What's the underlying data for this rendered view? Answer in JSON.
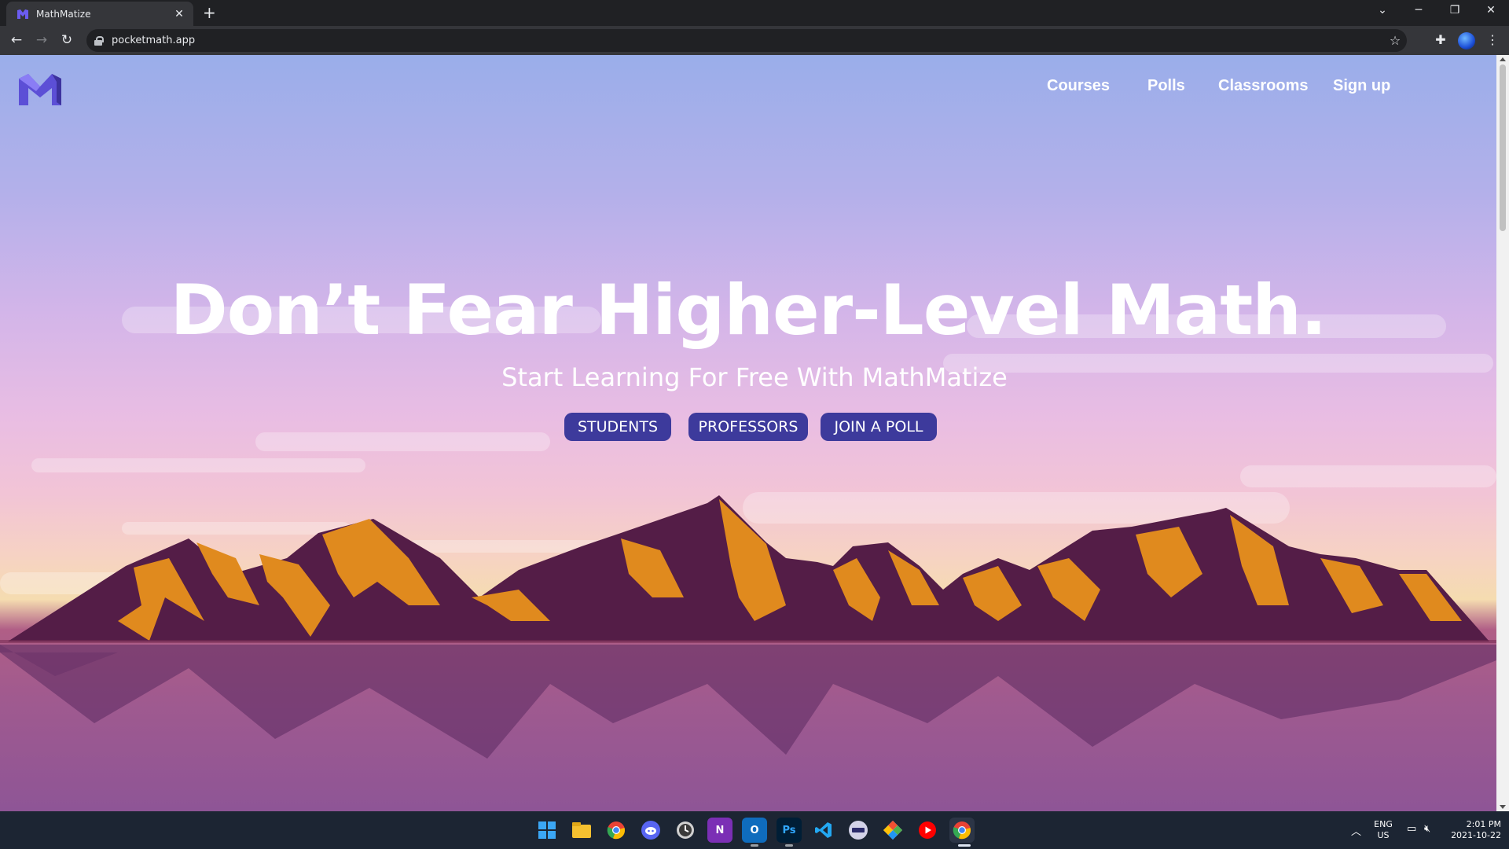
{
  "browser": {
    "tab_title": "MathMatize",
    "url": "pocketmath.app",
    "new_tab": "+",
    "tab_close": "✕"
  },
  "site": {
    "nav": [
      {
        "label": "Courses"
      },
      {
        "label": "Polls"
      },
      {
        "label": "Classrooms"
      },
      {
        "label": "Sign up"
      }
    ],
    "hero": {
      "title": "Don’t Fear Higher-Level Math.",
      "subtitle": "Start Learning For Free With MathMatize"
    },
    "buttons": [
      {
        "label": "STUDENTS"
      },
      {
        "label": "PROFESSORS"
      },
      {
        "label": "JOIN A POLL"
      }
    ],
    "colors": {
      "button_bg": "#3d3a9c",
      "mountain": "#541d47",
      "mountain_light": "#e08a1e"
    }
  },
  "taskbar": {
    "apps": [
      "windows-start",
      "file-explorer",
      "chrome",
      "discord",
      "clock-app",
      "onenote",
      "outlook",
      "photoshop",
      "vscode",
      "terminal",
      "git-app",
      "youtube-music",
      "chrome-active"
    ],
    "language": "ENG",
    "region": "US",
    "time": "2:01 PM",
    "date": "2021-10-22"
  }
}
